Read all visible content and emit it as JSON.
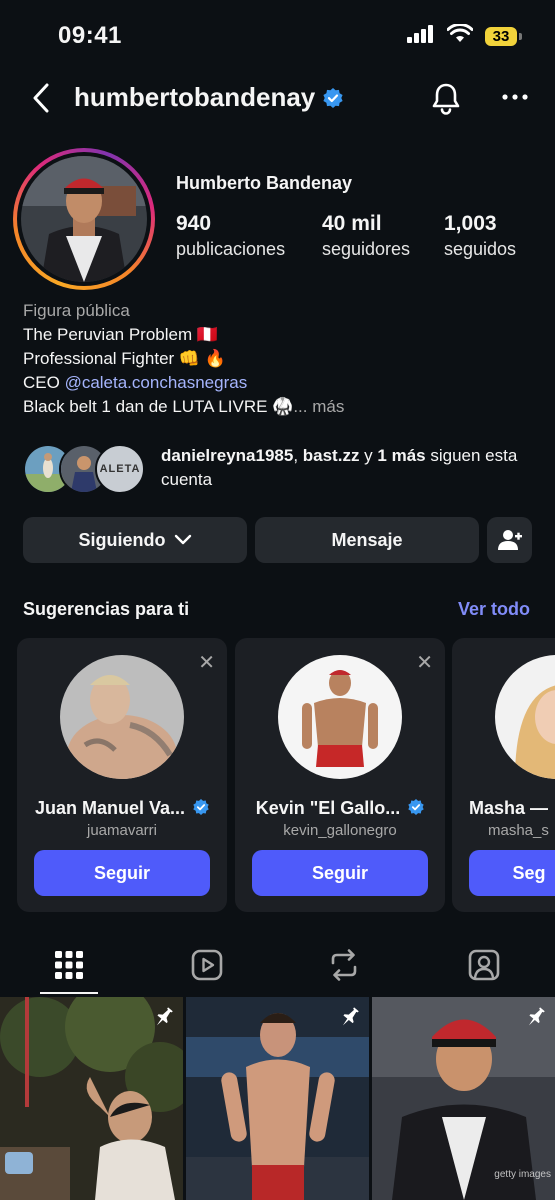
{
  "status_bar": {
    "time": "09:41",
    "battery": "33"
  },
  "header": {
    "username": "humbertobandenay"
  },
  "profile": {
    "full_name": "Humberto Bandenay",
    "stats": [
      {
        "value": "940",
        "label": "publicaciones"
      },
      {
        "value": "40 mil",
        "label": "seguidores"
      },
      {
        "value": "1,003",
        "label": "seguidos"
      }
    ],
    "bio": {
      "category": "Figura pública",
      "line1": "The Peruvian Problem 🇵🇪",
      "line2": "Professional Fighter 👊 🔥",
      "line3_prefix": "CEO ",
      "line3_mention": "@caleta.conchasnegras",
      "line4": "Black belt 1 dan de LUTA LIVRE 🥋",
      "more": "... más"
    },
    "followed_by": {
      "user1": "danielreyna1985",
      "sep1": ", ",
      "user2": "bast.zz",
      "sep2": " y ",
      "others": "1 más",
      "suffix": " siguen esta cuenta",
      "avatar3_text": "ALETA"
    }
  },
  "actions": {
    "following": "Siguiendo",
    "message": "Mensaje"
  },
  "suggestions": {
    "title": "Sugerencias para ti",
    "see_all": "Ver todo",
    "cards": [
      {
        "name": "Juan Manuel Va...",
        "handle": "juamavarri",
        "button": "Seguir"
      },
      {
        "name": "Kevin \"El Gallo...",
        "handle": "kevin_gallonegro",
        "button": "Seguir"
      },
      {
        "name": "Masha —",
        "handle": "masha_s",
        "button": "Seg"
      }
    ]
  },
  "grid": {
    "watermark": "getty images"
  },
  "colors": {
    "background": "#0c1014",
    "button_bg": "#25292e",
    "follow_button": "#4f5bfa",
    "link": "#818cf8",
    "verified": "#3897f0",
    "battery": "#f2d33b"
  }
}
